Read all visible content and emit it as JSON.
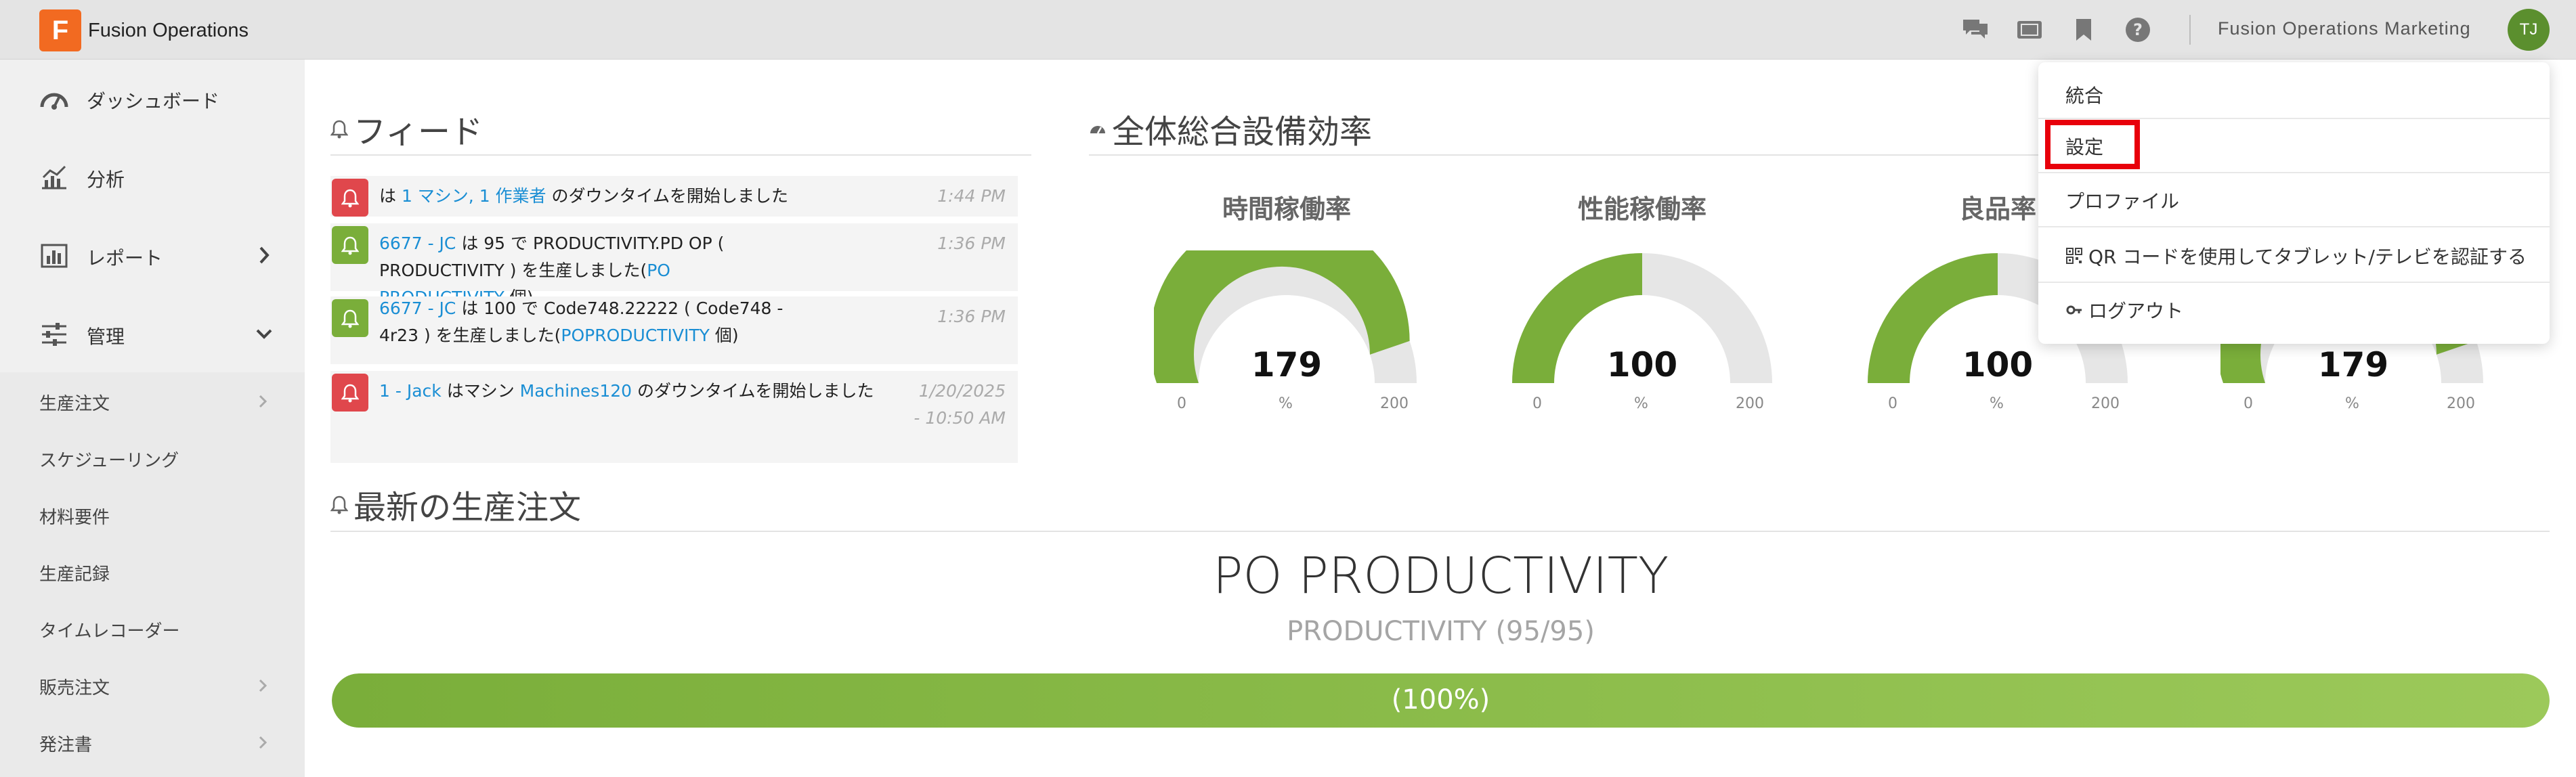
{
  "app": {
    "logo_letter": "F",
    "name": "Fusion Operations",
    "brand_color": "#f26a21",
    "accent_green": "#7aae3a",
    "alert_red": "#e0474c",
    "link_color": "#1a8ed4"
  },
  "topbar": {
    "icons": [
      "chat-icon",
      "tablet-icon",
      "bookmark-icon",
      "help-icon"
    ],
    "user_label": "Fusion Operations Marketing",
    "avatar_initials": "TJ"
  },
  "sidebar": {
    "main": [
      {
        "label": "ダッシュボード",
        "icon": "dashboard-icon"
      },
      {
        "label": "分析",
        "icon": "analytics-icon"
      },
      {
        "label": "レポート",
        "icon": "report-icon",
        "chevron": "right"
      },
      {
        "label": "管理",
        "icon": "sliders-icon",
        "chevron": "down"
      }
    ],
    "sub": [
      {
        "label": "生産注文",
        "chevron": true
      },
      {
        "label": "スケジューリング",
        "chevron": false
      },
      {
        "label": "材料要件",
        "chevron": false
      },
      {
        "label": "生産記録",
        "chevron": false
      },
      {
        "label": "タイムレコーダー",
        "chevron": false
      },
      {
        "label": "販売注文",
        "chevron": true
      },
      {
        "label": "発注書",
        "chevron": true
      }
    ]
  },
  "feed": {
    "title": "フィード",
    "items": [
      {
        "status": "red",
        "parts": [
          {
            "t": "は "
          },
          {
            "t": "1 マシン, 1 作業者",
            "link": true
          },
          {
            "t": " のダウンタイムを開始しました"
          }
        ],
        "time": "1:44 PM"
      },
      {
        "status": "green",
        "parts": [
          {
            "t": "6677 - JC",
            "link": true
          },
          {
            "t": " は 95 で PRODUCTIVITY.PD OP ( PRODUCTIVITY ) を生産しました("
          },
          {
            "t": "PO PRODUCTIVITY",
            "link": true
          },
          {
            "t": " 個)"
          }
        ],
        "time": "1:36 PM"
      },
      {
        "status": "green",
        "parts": [
          {
            "t": "6677 - JC",
            "link": true
          },
          {
            "t": " は 100 で Code748.22222 ( Code748 - 4r23 ) を生産しました("
          },
          {
            "t": "POPRODUCTIVITY",
            "link": true
          },
          {
            "t": " 個)"
          }
        ],
        "time": "1:36 PM"
      },
      {
        "status": "red",
        "parts": [
          {
            "t": "1 - Jack",
            "link": true
          },
          {
            "t": " はマシン "
          },
          {
            "t": "Machines120",
            "link": true
          },
          {
            "t": " のダウンタイムを開始しました"
          }
        ],
        "time": "1/20/2025 - 10:50 AM"
      }
    ]
  },
  "oee": {
    "title": "全体総合設備効率",
    "gauges": [
      {
        "title": "時間稼働率",
        "value": 179,
        "min": 0,
        "max": 200,
        "unit": "%"
      },
      {
        "title": "性能稼働率",
        "value": 100,
        "min": 0,
        "max": 200,
        "unit": "%"
      },
      {
        "title": "良品率",
        "value": 100,
        "min": 0,
        "max": 200,
        "unit": "%"
      },
      {
        "title": "",
        "value": 179,
        "min": 0,
        "max": 200,
        "unit": "%"
      }
    ]
  },
  "orders": {
    "title": "最新の生産注文",
    "po_name": "PO PRODUCTIVITY",
    "po_sub": "PRODUCTIVITY (95/95)",
    "progress_fraction": 1.0,
    "progress_label": "(100%)"
  },
  "dropdown": {
    "items": [
      {
        "label": "統合",
        "icon": ""
      },
      {
        "label": "設定",
        "icon": "",
        "highlighted": true
      },
      {
        "label": "プロファイル",
        "icon": ""
      },
      {
        "label": "QR コードを使用してタブレット/テレビを認証する",
        "icon": "qr-code-icon"
      },
      {
        "label": "ログアウト",
        "icon": "key-icon"
      }
    ]
  }
}
